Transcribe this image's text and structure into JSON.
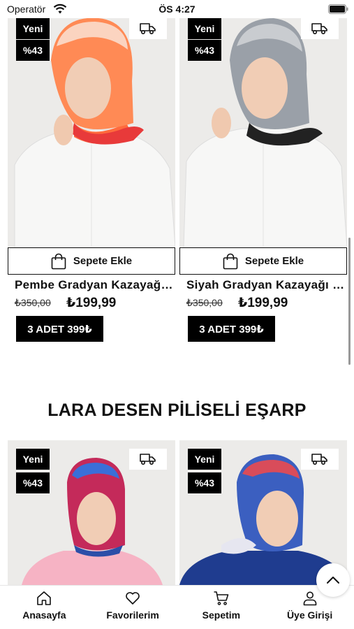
{
  "status_bar": {
    "carrier": "Operatör",
    "time": "ÖS 4:27"
  },
  "products_top": [
    {
      "badge_new": "Yeni",
      "badge_discount": "%43",
      "add_to_cart": "Sepete Ekle",
      "name": "Pembe Gradyan Kazayağı Desen Eşarp",
      "old_price": "₺350,00",
      "price": "₺199,99",
      "promo": "3 ADET 399₺"
    },
    {
      "badge_new": "Yeni",
      "badge_discount": "%43",
      "add_to_cart": "Sepete Ekle",
      "name": "Siyah Gradyan Kazayağı Desen Eşarp",
      "old_price": "₺350,00",
      "price": "₺199,99",
      "promo": "3 ADET 399₺"
    }
  ],
  "section": {
    "title": "LARA DESEN PİLİSELİ EŞARP"
  },
  "products_bottom": [
    {
      "badge_new": "Yeni",
      "badge_discount": "%43"
    },
    {
      "badge_new": "Yeni",
      "badge_discount": "%43"
    }
  ],
  "bottom_nav": [
    {
      "label": "Anasayfa",
      "icon": "home-icon"
    },
    {
      "label": "Favorilerim",
      "icon": "heart-icon"
    },
    {
      "label": "Sepetim",
      "icon": "cart-icon"
    },
    {
      "label": "Üye Girişi",
      "icon": "user-icon"
    }
  ]
}
